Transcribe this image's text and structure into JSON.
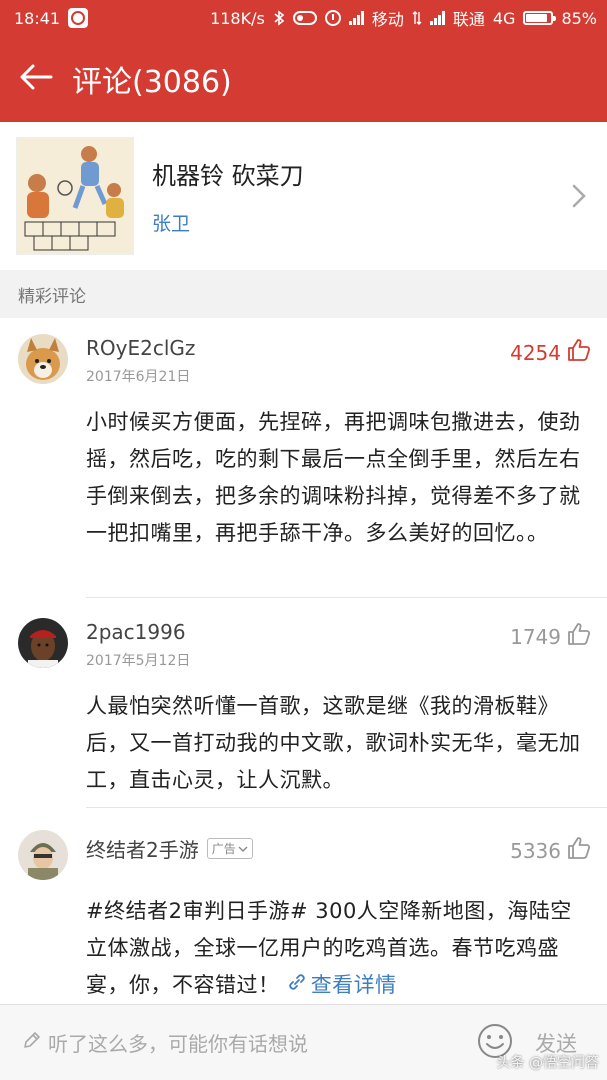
{
  "status_bar": {
    "time": "18:41",
    "net_speed": "118K/s",
    "carrier1": "移动",
    "carrier2": "联通",
    "network": "4G",
    "battery": "85%",
    "battery_level": 0.85
  },
  "header": {
    "title": "评论(3086)",
    "back_icon": "back-arrow-icon"
  },
  "article": {
    "title": "机器铃 砍菜刀",
    "author": "张卫",
    "arrow_icon": "chevron-right-icon"
  },
  "section": {
    "title": "精彩评论"
  },
  "comments": [
    {
      "username": "ROyE2clGz",
      "date": "2017年6月21日",
      "likes": "4254",
      "hot": true,
      "text": "小时候买方便面，先捏碎，再把调味包撒进去，使劲摇，然后吃，吃的剩下最后一点全倒手里，然后左右手倒来倒去，把多余的调味粉抖掉，觉得差不多了就一把扣嘴里，再把手舔干净。多么美好的回忆。。"
    },
    {
      "username": "2pac1996",
      "date": "2017年5月12日",
      "likes": "1749",
      "hot": false,
      "text": "人最怕突然听懂一首歌，这歌是继《我的滑板鞋》后，又一首打动我的中文歌，歌词朴实无华，毫无加工，直击心灵，让人沉默。"
    },
    {
      "username": "终结者2手游",
      "ad_label": "广告",
      "likes": "5336",
      "hot": false,
      "text": "#终结者2审判日手游# 300人空降新地图，海陆空立体激战，全球一亿用户的吃鸡首选。春节吃鸡盛宴，你，不容错过！",
      "link_label": "查看详情"
    }
  ],
  "bottom_bar": {
    "input_placeholder": "听了这么多，可能你有话想说",
    "send_label": "发送",
    "watermark": "头条 @悟空问答"
  },
  "colors": {
    "brand_red": "#d43c33",
    "link_blue": "#3d7ec0"
  }
}
